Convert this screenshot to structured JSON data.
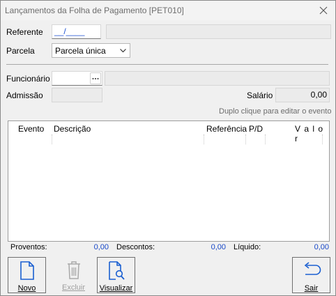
{
  "window": {
    "title": "Lançamentos da Folha de Pagamento [PET010]"
  },
  "form": {
    "referente_label": "Referente",
    "referente_value": "__/____",
    "parcela_label": "Parcela",
    "parcela_value": "Parcela única",
    "funcionario_label": "Funcionário",
    "funcionario_value": "",
    "admissao_label": "Admissão",
    "admissao_value": "",
    "salario_label": "Salário",
    "salario_value": "0,00",
    "hint": "Duplo clique para editar o evento"
  },
  "grid": {
    "columns": [
      "Evento",
      "Descrição",
      "Referência",
      "P/D",
      "V a l o r"
    ],
    "rows": []
  },
  "totals": {
    "proventos_label": "Proventos:",
    "proventos_value": "0,00",
    "descontos_label": "Descontos:",
    "descontos_value": "0,00",
    "liquido_label": "Líquido:",
    "liquido_value": "0,00"
  },
  "toolbar": {
    "novo": "Novo",
    "excluir": "Excluir",
    "visualizar": "Visualizar",
    "sair": "Sair"
  },
  "colors": {
    "accent": "#1a5fd1",
    "value_blue": "#1747c8"
  }
}
